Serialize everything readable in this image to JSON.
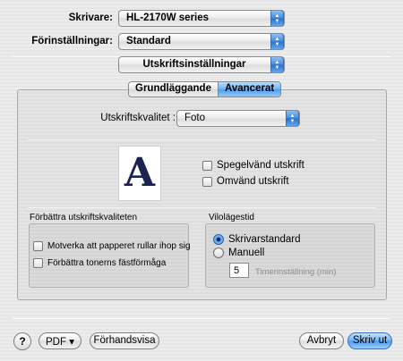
{
  "printer": {
    "label": "Skrivare:",
    "value": "HL-2170W series"
  },
  "presets": {
    "label": "Förinställningar:",
    "value": "Standard"
  },
  "section": {
    "value": "Utskriftsinställningar"
  },
  "tabs": [
    {
      "label": "Grundläggande",
      "selected": false
    },
    {
      "label": "Avancerat",
      "selected": true
    }
  ],
  "quality": {
    "label": "Utskriftskvalitet :",
    "value": "Foto"
  },
  "preview": {
    "letter": "A"
  },
  "options": {
    "mirror": {
      "label": "Spegelvänd utskrift",
      "checked": false
    },
    "reverse": {
      "label": "Omvänd utskrift",
      "checked": false
    }
  },
  "improve": {
    "title": "Förbättra utskriftskvaliteten",
    "curl": {
      "label": "Motverka att papperet rullar ihop sig",
      "checked": false
    },
    "toner": {
      "label": "Förbättra tonerns fästförmåga",
      "checked": false
    }
  },
  "sleep": {
    "title": "Vilolägestid",
    "default_label": "Skrivarstandard",
    "manual_label": "Manuell",
    "selected": "Skrivarstandard",
    "timer_value": "5",
    "timer_label": "Timerinställning (min)"
  },
  "footer": {
    "help_glyph": "?",
    "pdf_label": "PDF ▾",
    "preview_label": "Förhandsvisa",
    "cancel_label": "Avbryt",
    "print_label": "Skriv ut"
  },
  "colors": {
    "accent": "#4b98ec",
    "preview_letter": "#1d2350"
  }
}
